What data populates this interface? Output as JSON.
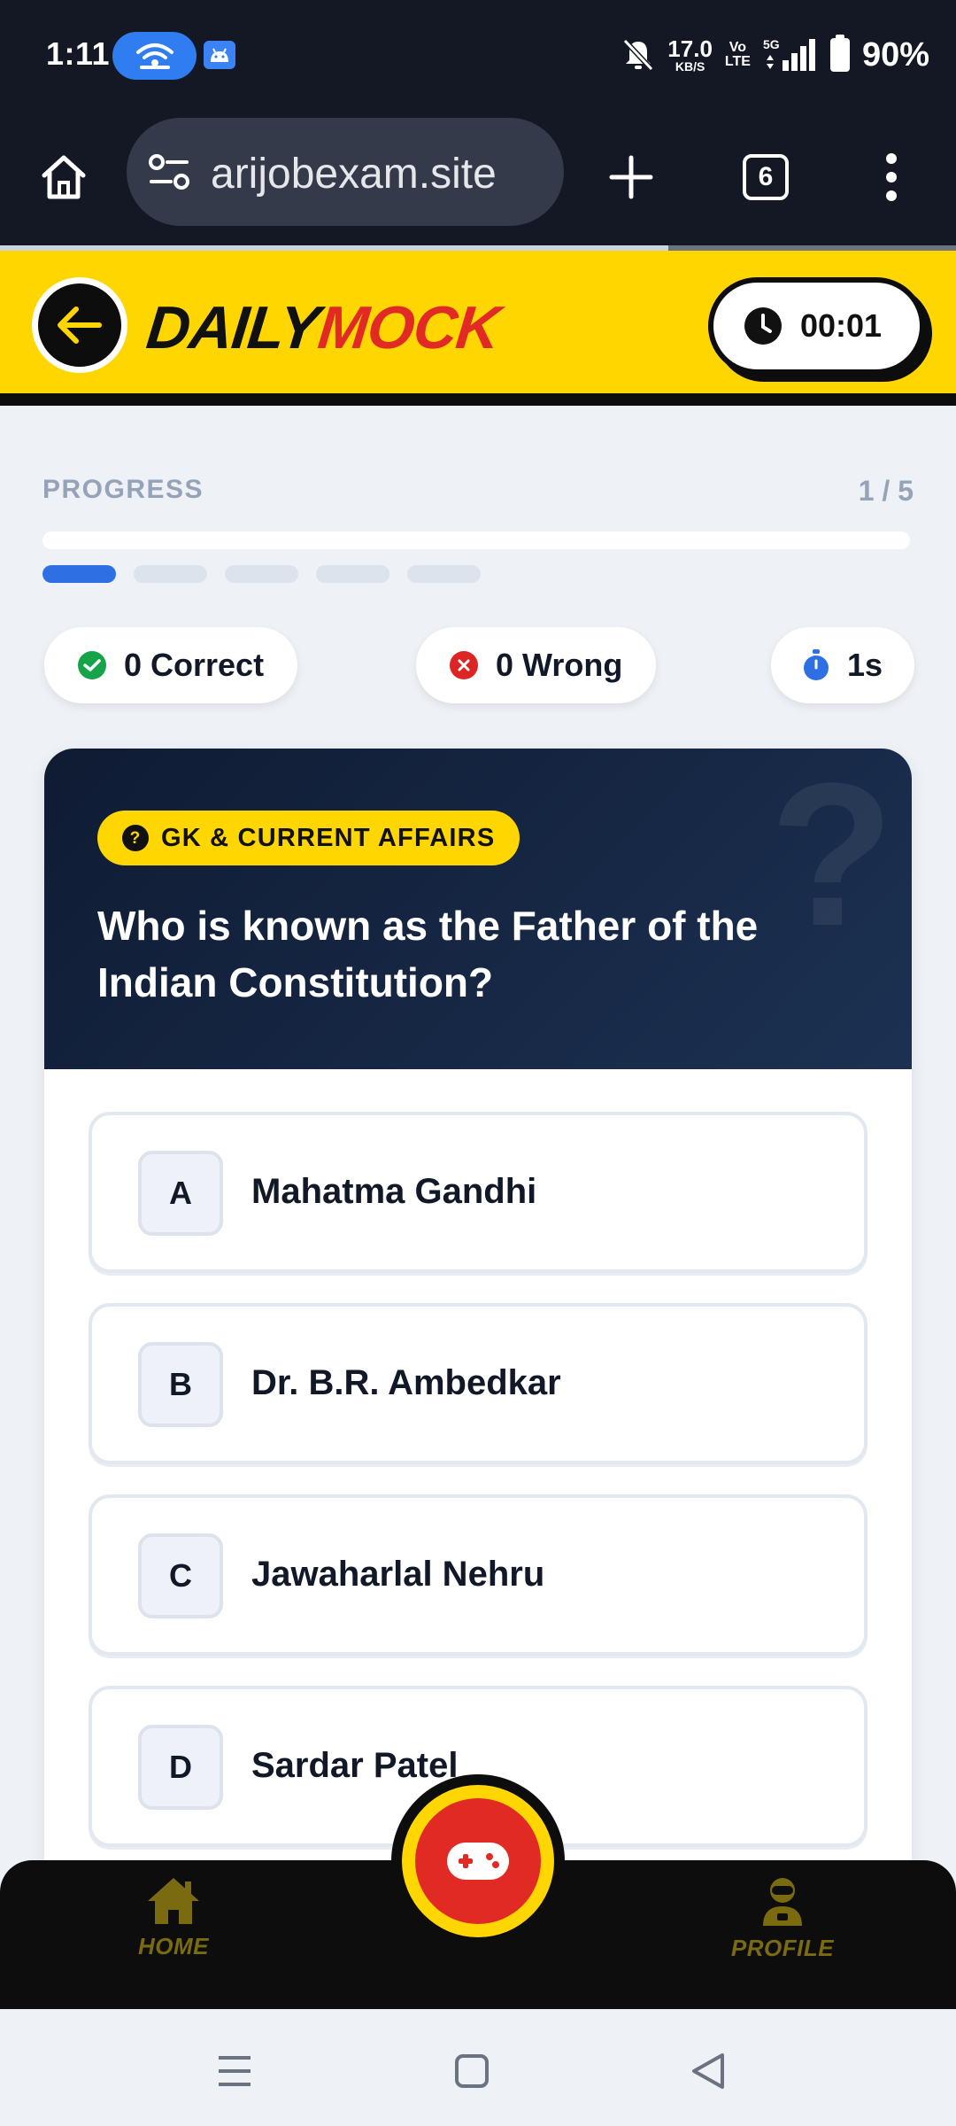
{
  "status_bar": {
    "time": "1:11",
    "net_speed_value": "17.0",
    "net_speed_unit": "KB/S",
    "volte_top": "Vo",
    "volte_bottom": "LTE",
    "network_gen": "5G",
    "battery": "90%"
  },
  "browser": {
    "url": "arijobexam.site",
    "tab_count": "6"
  },
  "header": {
    "logo_part1": "DAILY",
    "logo_part2": "MOCK",
    "timer": "00:01"
  },
  "progress": {
    "label": "PROGRESS",
    "count": "1 / 5",
    "current": 1,
    "total": 5
  },
  "stats": {
    "correct": "0 Correct",
    "wrong": "0 Wrong",
    "time": "1s"
  },
  "question": {
    "category": "GK & CURRENT AFFAIRS",
    "text": "Who is known as the Father of the Indian Constitution?",
    "options": [
      {
        "letter": "A",
        "text": "Mahatma Gandhi"
      },
      {
        "letter": "B",
        "text": "Dr. B.R. Ambedkar"
      },
      {
        "letter": "C",
        "text": "Jawaharlal Nehru"
      },
      {
        "letter": "D",
        "text": "Sardar Patel"
      }
    ]
  },
  "bottom_nav": {
    "home": "HOME",
    "profile": "PROFILE"
  },
  "colors": {
    "brand_yellow": "#ffd600",
    "brand_red": "#e22a25",
    "progress_blue": "#2f6fe4",
    "card_dark": "#0f1b33"
  },
  "icons": {
    "home": "home-icon",
    "site_settings": "tune-icon",
    "new_tab": "plus-icon",
    "menu": "more-vert-icon",
    "back": "arrow-left-icon",
    "timer": "clock-icon",
    "correct": "check-circle-icon",
    "wrong": "x-circle-icon",
    "stopwatch": "stopwatch-icon",
    "category": "question-circle-icon",
    "play": "gamepad-icon",
    "profile": "robot-avatar-icon"
  }
}
